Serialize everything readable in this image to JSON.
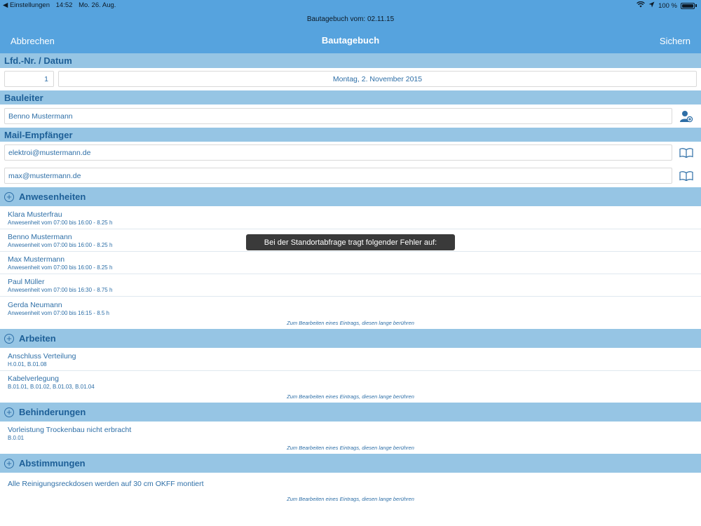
{
  "status": {
    "back_label": "◀ Einstellungen",
    "time": "14:52",
    "date": "Mo. 26. Aug.",
    "battery": "100 %"
  },
  "nav": {
    "subtitle": "Bautagebuch vom:  02.11.15",
    "title": "Bautagebuch",
    "cancel_label": "Abbrechen",
    "save_label": "Sichern"
  },
  "sections": {
    "lfd": {
      "header": "Lfd.-Nr. / Datum",
      "number": "1",
      "date": "Montag, 2. November 2015"
    },
    "bauleiter": {
      "header": "Bauleiter",
      "value": "Benno Mustermann"
    },
    "mail": {
      "header": "Mail-Empfänger",
      "recipients": [
        "elektroi@mustermann.de",
        "max@mustermann.de"
      ]
    },
    "anwesenheiten": {
      "header": "Anwesenheiten",
      "items": [
        {
          "name": "Klara Musterfrau",
          "detail": "Anwesenheit vom 07:00 bis 16:00 - 8.25 h"
        },
        {
          "name": "Benno Mustermann",
          "detail": "Anwesenheit vom 07:00 bis 16:00 - 8.25 h"
        },
        {
          "name": "Max Mustermann",
          "detail": "Anwesenheit vom 07:00 bis 16:00 - 8.25 h"
        },
        {
          "name": "Paul Müller",
          "detail": "Anwesenheit vom 07:00 bis 16:30 - 8.75 h"
        },
        {
          "name": "Gerda Neumann",
          "detail": "Anwesenheit vom 07:00 bis 16:15 - 8.5 h"
        }
      ],
      "hint": "Zum Bearbeiten eines Eintrags, diesen lange berühren"
    },
    "arbeiten": {
      "header": "Arbeiten",
      "items": [
        {
          "name": "Anschluss Verteilung",
          "detail": "H.0.01, B.01.08"
        },
        {
          "name": "Kabelverlegung",
          "detail": "B.01.01, B.01.02, B.01.03, B.01.04"
        }
      ],
      "hint": "Zum Bearbeiten eines Eintrags, diesen lange berühren"
    },
    "behinderungen": {
      "header": "Behinderungen",
      "items": [
        {
          "name": "Vorleistung Trockenbau nicht erbracht",
          "detail": "B.0.01"
        }
      ],
      "hint": "Zum Bearbeiten eines Eintrags, diesen lange berühren"
    },
    "abstimmungen": {
      "header": "Abstimmungen",
      "items": [
        {
          "name": "Alle Reinigungsreckdosen werden auf 30 cm OKFF montiert"
        }
      ],
      "hint": "Zum Bearbeiten eines Eintrags, diesen lange berühren"
    }
  },
  "toast": "Bei der Standortabfrage tragt folgender Fehler auf:",
  "colors": {
    "nav": "#56a3de",
    "section": "#96c5e4",
    "text": "#2e6fa7"
  }
}
